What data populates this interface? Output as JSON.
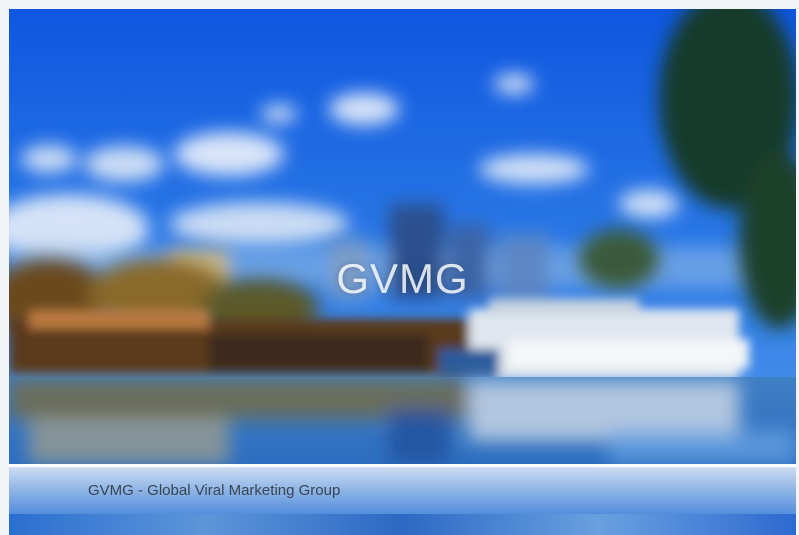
{
  "slide": {
    "title": "GVMG",
    "caption": "GVMG - Global Viral Marketing Group"
  },
  "colors": {
    "sky": "#1e63d8",
    "caption_text": "#3a4552",
    "page_background": "#f3f4f5"
  }
}
